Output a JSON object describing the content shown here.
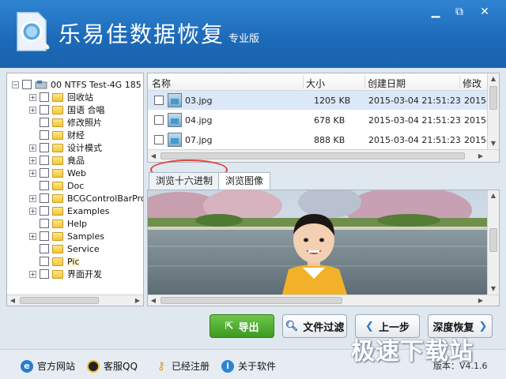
{
  "app": {
    "title": "乐易佳数据恢复",
    "edition": "专业版",
    "window_controls": {
      "minimize": "▁",
      "maximize": "⧉",
      "close": "✕"
    }
  },
  "tree": {
    "drive_label": "00  NTFS  Test-4G  185",
    "items": [
      {
        "label": "回收站",
        "expandable": true
      },
      {
        "label": "国语 合唱",
        "expandable": true
      },
      {
        "label": "修改照片",
        "expandable": false
      },
      {
        "label": "财经",
        "expandable": false
      },
      {
        "label": "设计模式",
        "expandable": true
      },
      {
        "label": "竟品",
        "expandable": true
      },
      {
        "label": "Web",
        "expandable": true
      },
      {
        "label": "Doc",
        "expandable": false
      },
      {
        "label": "BCGControlBarPro1",
        "expandable": true
      },
      {
        "label": "Examples",
        "expandable": true
      },
      {
        "label": "Help",
        "expandable": false
      },
      {
        "label": "Samples",
        "expandable": true
      },
      {
        "label": "Service",
        "expandable": false
      },
      {
        "label": "Pic",
        "expandable": false,
        "selected": true
      },
      {
        "label": "界面开发",
        "expandable": true
      }
    ]
  },
  "filelist": {
    "columns": [
      "名称",
      "大小",
      "创建日期",
      "修改"
    ],
    "rows": [
      {
        "name": "03.jpg",
        "size": "1205 KB",
        "created": "2015-03-04  21:51:23",
        "modified": "2015-",
        "selected": true
      },
      {
        "name": "04.jpg",
        "size": "678 KB",
        "created": "2015-03-04  21:51:23",
        "modified": "2015-",
        "selected": false
      },
      {
        "name": "07.jpg",
        "size": "888 KB",
        "created": "2015-03-04  21:51:23",
        "modified": "2015-",
        "selected": false
      }
    ]
  },
  "tabs": {
    "hex": "浏览十六进制",
    "image": "浏览图像"
  },
  "actions": {
    "export": "导出",
    "filter": "文件过滤",
    "prev": "上一步",
    "deep": "深度恢复"
  },
  "footer": {
    "site": "官方网站",
    "qq": "客服QQ",
    "registered": "已经注册",
    "about": "关于软件",
    "version_label": "版本：",
    "version": "V4.1.6"
  },
  "watermark": "极速下载站",
  "colors": {
    "titlebar": "#1c69b8",
    "export_green": "#3c9b22",
    "highlight_red": "#e0443a"
  }
}
